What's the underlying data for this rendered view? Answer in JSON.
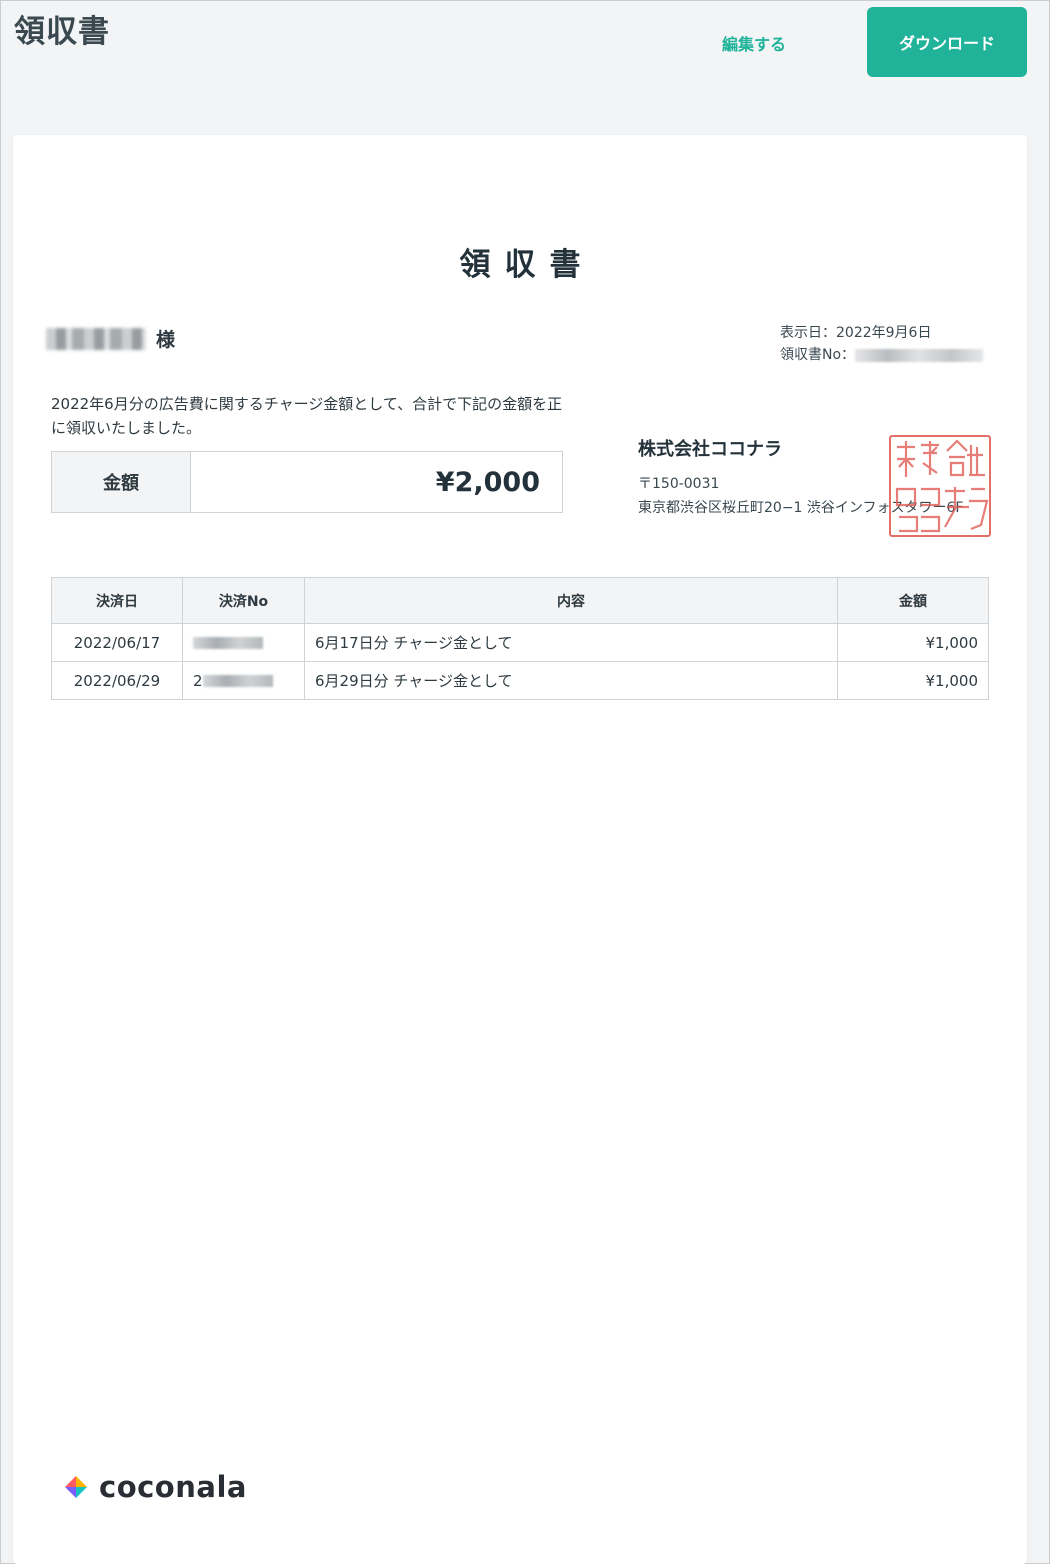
{
  "header": {
    "title": "領収書",
    "edit_label": "編集する",
    "download_label": "ダウンロード"
  },
  "document": {
    "title": "領収書",
    "recipient_suffix": "様",
    "display_date_label": "表示日：",
    "display_date": "2022年9月6日",
    "receipt_no_label": "領収書No：",
    "statement": "2022年6月分の広告費に関するチャージ金額として、合計で下記の金額を正に領収いたしました。",
    "amount_label": "金額",
    "amount_value": "¥2,000",
    "company": {
      "name": "株式会社ココナラ",
      "postal": "〒150-0031",
      "address": "東京都渋谷区桜丘町20−1 渋谷インフォスタワー6F",
      "seal_text": "株式会社ココナラ"
    }
  },
  "table": {
    "headers": [
      "決済日",
      "決済No",
      "内容",
      "金額"
    ],
    "rows": [
      {
        "date": "2022/06/17",
        "no_prefix": "",
        "content": "6月17日分 チャージ金として",
        "amount": "¥1,000"
      },
      {
        "date": "2022/06/29",
        "no_prefix": "2",
        "content": "6月29日分 チャージ金として",
        "amount": "¥1,000"
      }
    ]
  },
  "footer": {
    "logo_text": "coconala"
  },
  "colors": {
    "accent": "#20b39a",
    "seal": "#e0564e"
  }
}
